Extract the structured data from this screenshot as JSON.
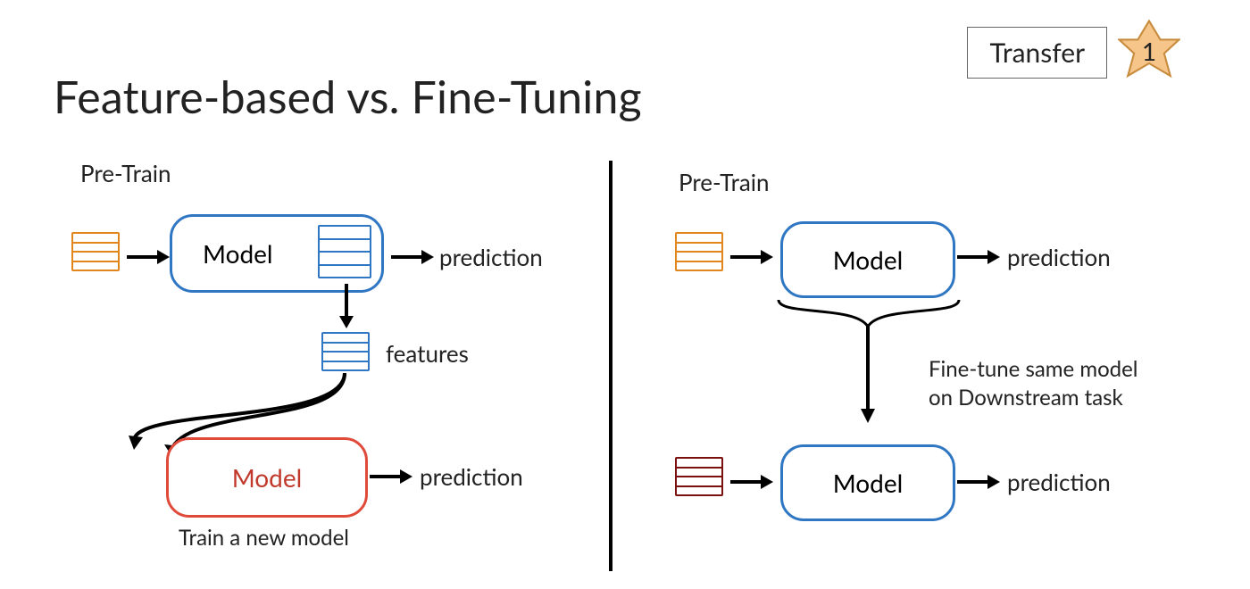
{
  "header": {
    "title": "Feature-based vs. Fine-Tuning",
    "transfer_label": "Transfer",
    "step_number": "1"
  },
  "left": {
    "heading": "Pre-Train",
    "model_top": "Model",
    "prediction_top": "prediction",
    "features_label": "features",
    "model_bottom": "Model",
    "prediction_bottom": "prediction",
    "caption_bottom": "Train a new model"
  },
  "right": {
    "heading": "Pre-Train",
    "model_top": "Model",
    "prediction_top": "prediction",
    "annotation_line1": "Fine-tune same model",
    "annotation_line2": "on Downstream task",
    "model_bottom": "Model",
    "prediction_bottom": "prediction"
  },
  "colors": {
    "blue": "#2f76c3",
    "red": "#e04a3a",
    "orange": "#e0861a",
    "dark_red": "#7b1010",
    "star_fill": "#f6c58a",
    "star_stroke": "#c88c3e"
  }
}
